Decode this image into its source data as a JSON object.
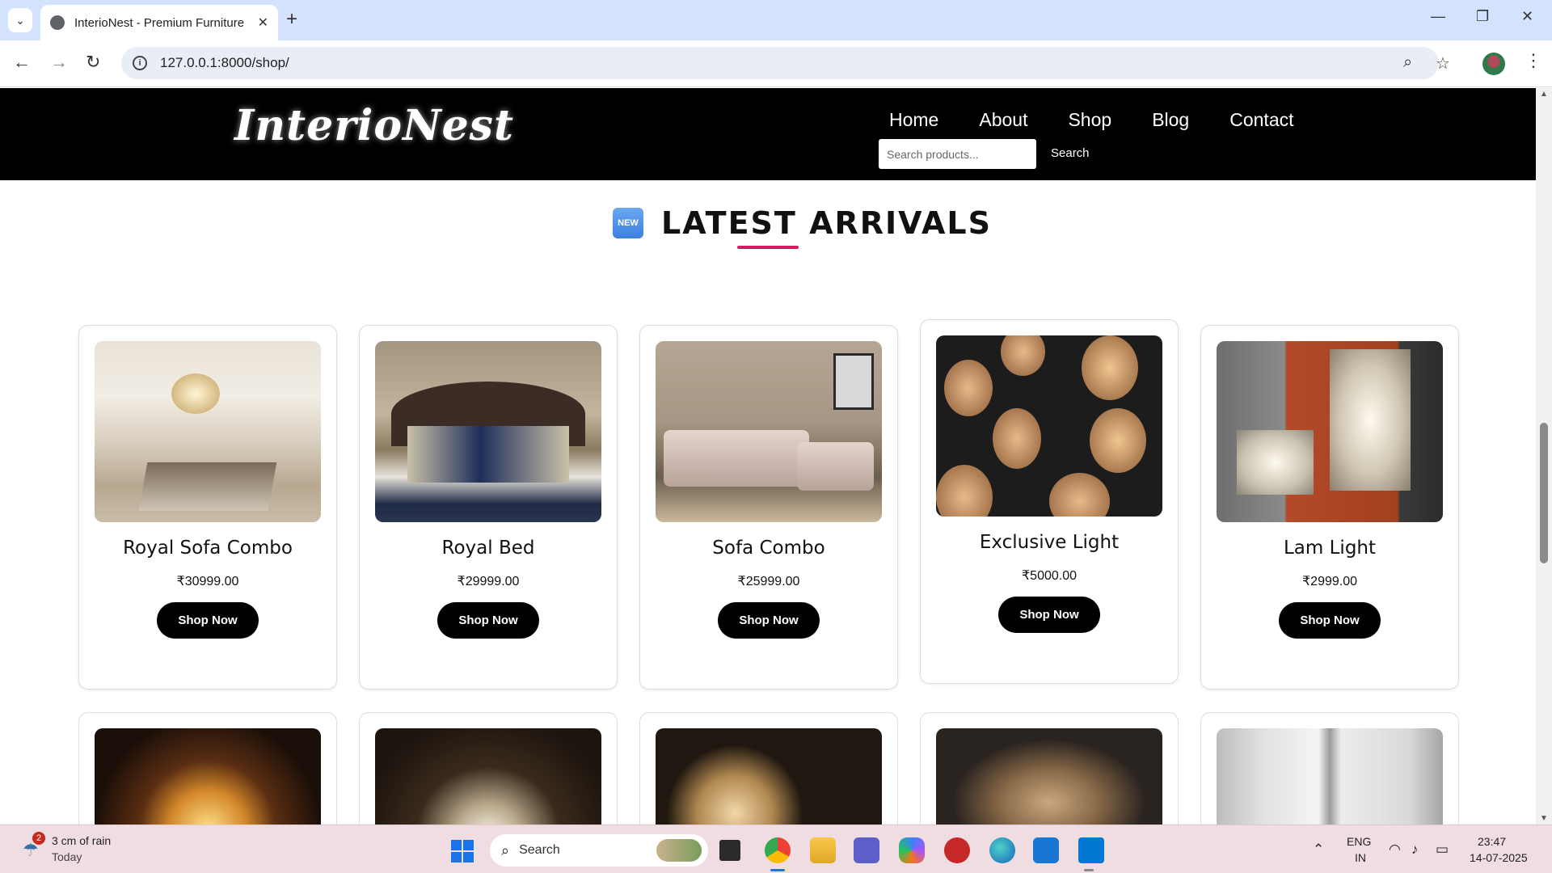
{
  "browser": {
    "tab_title": "InterioNest - Premium Furniture",
    "url": "127.0.0.1:8000/shop/",
    "icons": [
      "chevron-down-icon",
      "globe-icon",
      "close-icon",
      "plus-icon",
      "minimize-icon",
      "restore-icon",
      "close-window-icon",
      "back-icon",
      "forward-icon",
      "reload-icon",
      "info-icon",
      "zoom-icon",
      "star-icon",
      "avatar",
      "kebab-icon"
    ]
  },
  "site": {
    "logo": "InterioNest",
    "nav": [
      "Home",
      "About",
      "Shop",
      "Blog",
      "Contact"
    ],
    "search_placeholder": "Search products...",
    "search_button": "Search"
  },
  "section": {
    "badge": "NEW",
    "title": "LATEST ARRIVALS",
    "accent_color": "#d81b60"
  },
  "products": [
    {
      "name": "Royal Sofa Combo",
      "price": "₹30999.00",
      "button": "Shop Now"
    },
    {
      "name": "Royal Bed",
      "price": "₹29999.00",
      "button": "Shop Now"
    },
    {
      "name": "Sofa Combo",
      "price": "₹25999.00",
      "button": "Shop Now"
    },
    {
      "name": "Exclusive Light",
      "price": "₹5000.00",
      "button": "Shop Now"
    },
    {
      "name": "Lam Light",
      "price": "₹2999.00",
      "button": "Shop Now"
    }
  ],
  "taskbar": {
    "weather_badge": "2",
    "weather_main": "3 cm of rain",
    "weather_sub": "Today",
    "search_label": "Search",
    "lang_top": "ENG",
    "lang_bottom": "IN",
    "time": "23:47",
    "date": "14-07-2025"
  }
}
